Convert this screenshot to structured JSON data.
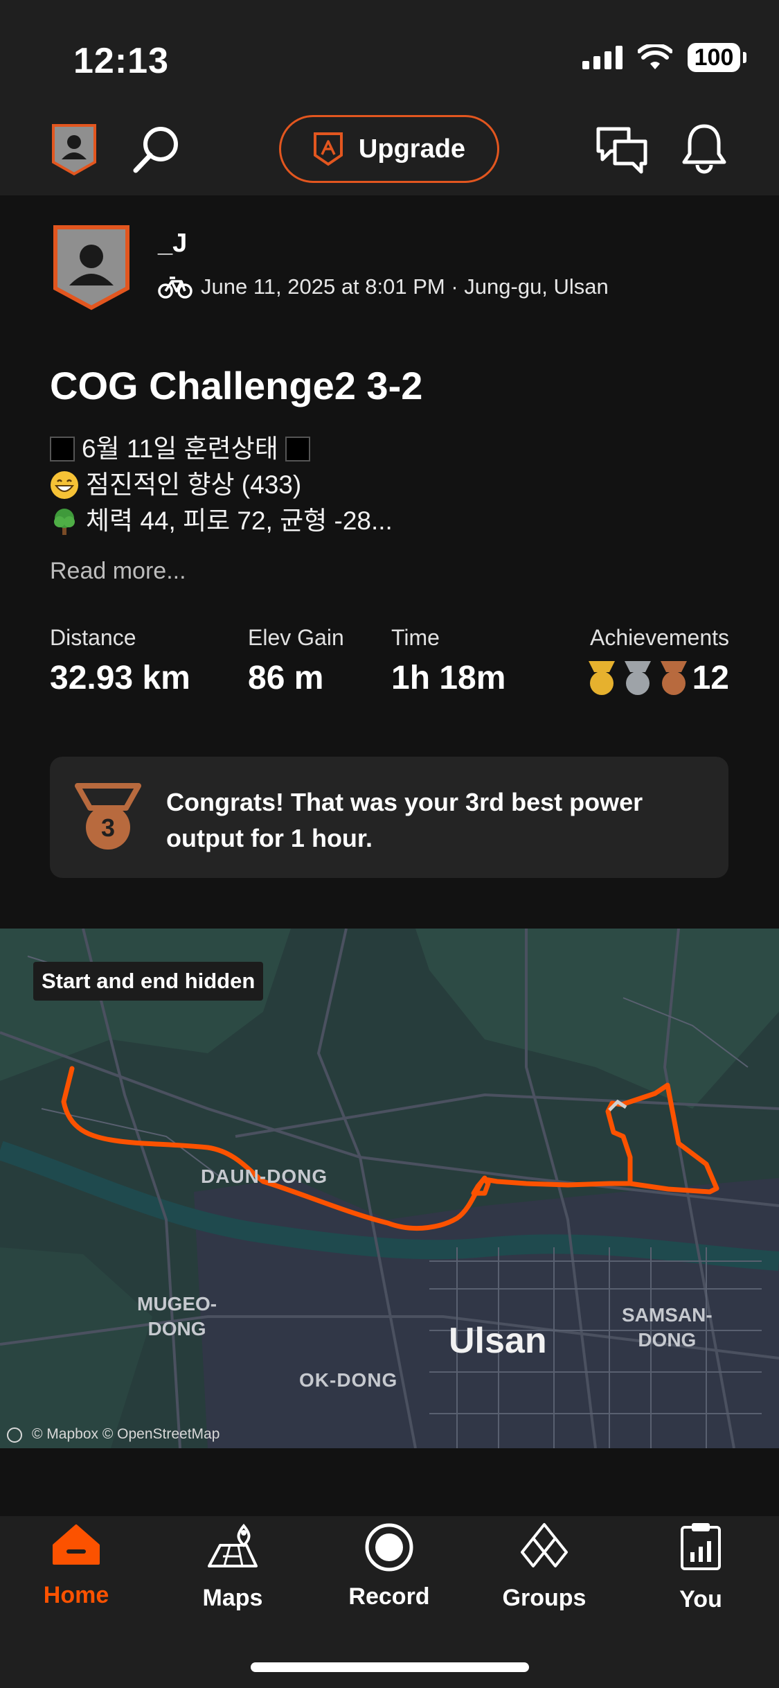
{
  "status_bar": {
    "time": "12:13",
    "battery": "100"
  },
  "header": {
    "upgrade_label": "Upgrade"
  },
  "activity": {
    "athlete_name": "_J",
    "meta": "June 11, 2025 at 8:01 PM · Jung-gu, Ulsan",
    "title": "COG Challenge2 3-2",
    "description_lines": [
      "6월 11일 훈련상태",
      "점진적인 향상 (433)",
      "체력 44, 피로 72, 균형 -28..."
    ],
    "read_more": "Read more...",
    "stats": [
      {
        "label": "Distance",
        "value": "32.93 km"
      },
      {
        "label": "Elev Gain",
        "value": "86 m"
      },
      {
        "label": "Time",
        "value": "1h 18m"
      },
      {
        "label": "Achievements",
        "value": "12"
      }
    ],
    "congrats": "Congrats! That was your 3rd best power output for 1 hour.",
    "medal_rank": "3"
  },
  "map": {
    "badge": "Start and end hidden",
    "labels": {
      "daun": "DAUN-DONG",
      "mugeo1": "MUGEO-",
      "mugeo2": "DONG",
      "ulsan": "Ulsan",
      "samsan1": "SAMSAN-",
      "samsan2": "DONG",
      "okdong": "OK-DONG"
    },
    "attribution": "© Mapbox © OpenStreetMap"
  },
  "tabbar": {
    "home": "Home",
    "maps": "Maps",
    "record": "Record",
    "groups": "Groups",
    "you": "You"
  },
  "colors": {
    "accent": "#e2561f",
    "gold": "#e6b12e",
    "silver": "#9ea3a8",
    "bronze": "#b86a3e"
  }
}
